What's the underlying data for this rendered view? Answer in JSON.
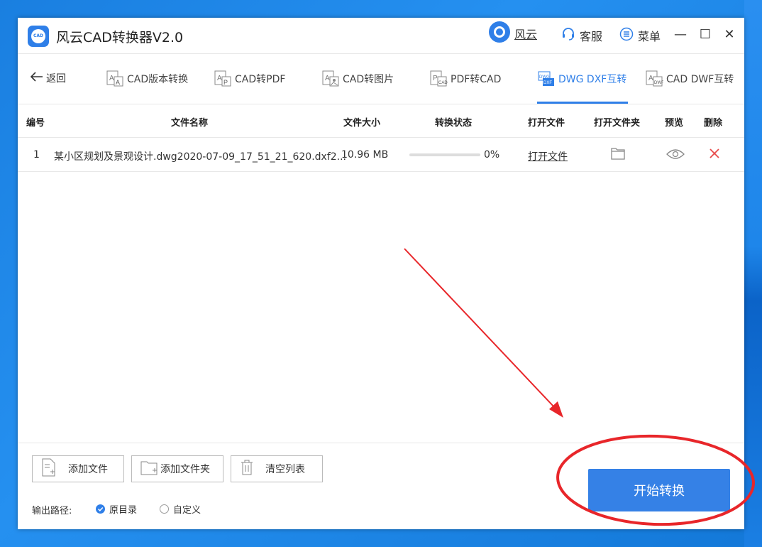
{
  "window": {
    "app_title": "风云CAD转换器V2.0",
    "fengyun_label": "风云",
    "service_label": "客服",
    "menu_label": "菜单",
    "minimize_glyph": "—",
    "maximize_glyph": "☐",
    "close_glyph": "✕"
  },
  "nav": {
    "back_label": "返回",
    "tabs": [
      {
        "label": "CAD版本转换",
        "icon": "version-convert-icon"
      },
      {
        "label": "CAD转PDF",
        "icon": "pdf-convert-icon"
      },
      {
        "label": "CAD转图片",
        "icon": "image-convert-icon"
      },
      {
        "label": "PDF转CAD",
        "icon": "pdf-to-cad-icon"
      },
      {
        "label": "DWG DXF互转",
        "icon": "dwg-dxf-icon",
        "active": true
      },
      {
        "label": "CAD DWF互转",
        "icon": "dwf-convert-icon"
      }
    ]
  },
  "table": {
    "headers": {
      "index": "编号",
      "filename": "文件名称",
      "size": "文件大小",
      "status": "转换状态",
      "open_file": "打开文件",
      "open_folder": "打开文件夹",
      "preview": "预览",
      "delete": "删除"
    },
    "rows": [
      {
        "index": "1",
        "filename": "某小区规划及景观设计.dwg2020-07-09_17_51_21_620.dxf2...",
        "size": "10.96 MB",
        "progress": 0,
        "progress_text": "0%",
        "open_file": "打开文件"
      }
    ]
  },
  "bottom": {
    "add_file": "添加文件",
    "add_folder": "添加文件夹",
    "clear_list": "清空列表",
    "output_label": "输出路径:",
    "option_original": "原目录",
    "option_custom": "自定义",
    "start_button": "开始转换"
  },
  "colors": {
    "accent": "#2f7fe8",
    "delete": "#e84a4a",
    "annotation": "#e8262a"
  }
}
